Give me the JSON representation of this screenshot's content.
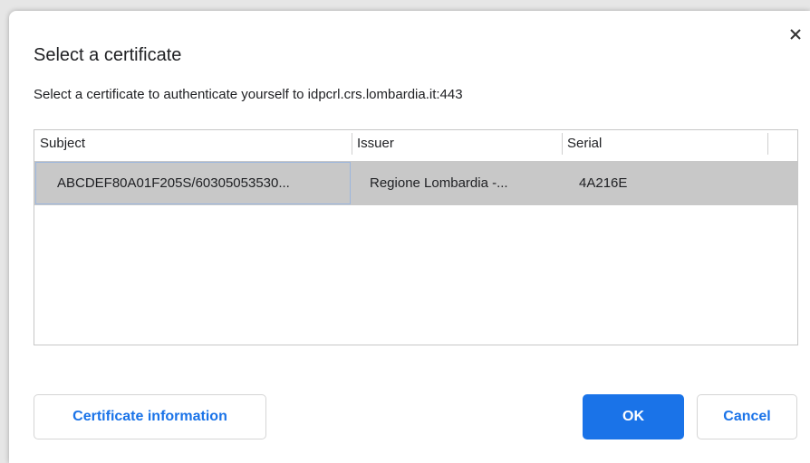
{
  "dialog": {
    "title": "Select a certificate",
    "subtitle": "Select a certificate to authenticate yourself to idpcrl.crs.lombardia.it:443",
    "close_icon": "close-icon"
  },
  "table": {
    "columns": [
      "Subject",
      "Issuer",
      "Serial"
    ],
    "rows": [
      {
        "subject": "ABCDEF80A01F205S/60305053530...",
        "issuer": "Regione Lombardia -...",
        "serial": "4A216E",
        "selected": true
      }
    ]
  },
  "buttons": {
    "certificate_info": "Certificate information",
    "ok": "OK",
    "cancel": "Cancel"
  },
  "colors": {
    "accent": "#1a73e8",
    "selected_row": "#c8c8c8",
    "focus_border": "#9bb6de"
  }
}
